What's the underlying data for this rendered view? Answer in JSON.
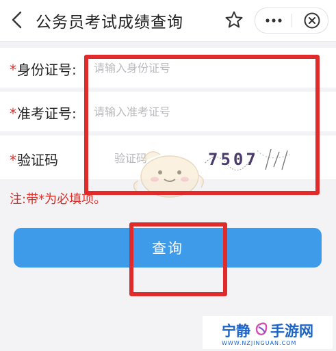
{
  "header": {
    "title": "公务员考试成绩查询",
    "icons": [
      "back-icon",
      "star-icon",
      "more-icon",
      "close-icon"
    ]
  },
  "form": {
    "id_card": {
      "asterisk": "*",
      "label": "身份证号:",
      "placeholder": "请输入身份证号",
      "value": ""
    },
    "ticket": {
      "asterisk": "*",
      "label": "准考证号:",
      "placeholder": "请输入准考证号",
      "value": ""
    },
    "captcha": {
      "asterisk": "*",
      "label": "验证码",
      "placeholder": "验证码",
      "value": "",
      "image_text": "7507"
    }
  },
  "note": "注:带*为必填项。",
  "query_button": "查询",
  "colors": {
    "accent": "#3d9bea",
    "required": "#d9302a",
    "highlight": "#e12a2a",
    "watermark": "#1c63c7"
  },
  "watermark": {
    "text_left": "宁静",
    "text_right": "手游网",
    "url": "WWW.NZJINGUAN.COM"
  }
}
